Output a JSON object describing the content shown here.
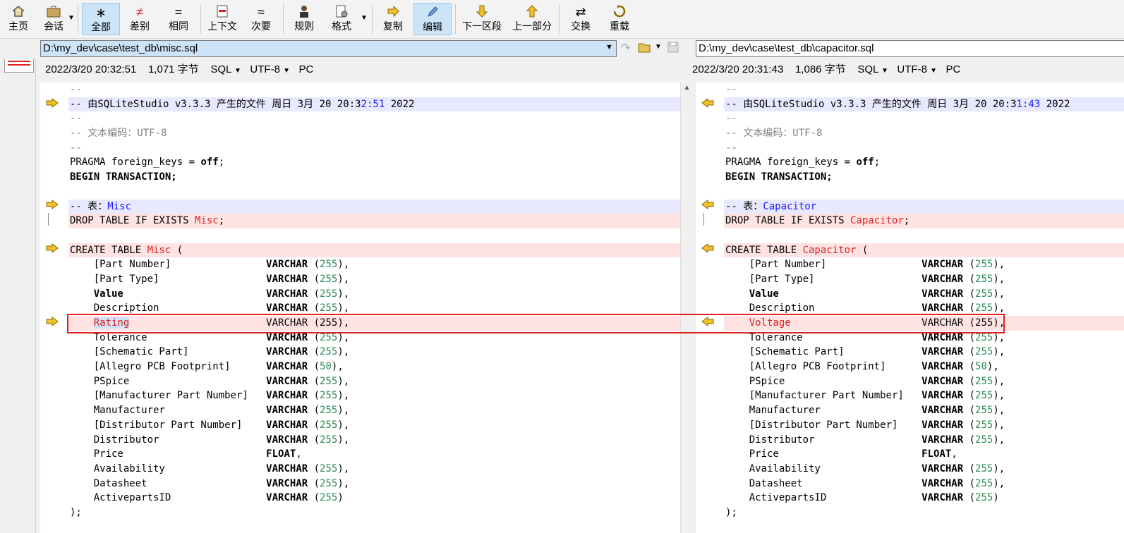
{
  "toolbar": {
    "home": "主页",
    "session": "会话",
    "all": "全部",
    "diffs": "差别",
    "same": "相同",
    "context": "上下文",
    "minor": "次要",
    "rules": "规则",
    "format": "格式",
    "copy": "复制",
    "edit": "编辑",
    "next_section": "下一区段",
    "prev_part": "上一部分",
    "swap": "交换",
    "reload": "重载"
  },
  "left": {
    "path": "D:\\my_dev\\case\\test_db\\misc.sql",
    "date": "2022/3/20 20:32:51",
    "size": "1,071 字节",
    "format": "SQL",
    "encoding": "UTF-8",
    "lineend": "PC",
    "header_time_a": "-- 由SQLiteStudio v3.3.3 产生的文件 周日 3月 20 20:3",
    "header_time_b": "2:51",
    "header_time_c": " 2022",
    "table_name": "Misc",
    "changed_col": "Rating"
  },
  "right": {
    "path": "D:\\my_dev\\case\\test_db\\capacitor.sql",
    "date": "2022/3/20 20:31:43",
    "size": "1,086 字节",
    "format": "SQL",
    "encoding": "UTF-8",
    "lineend": "PC",
    "header_time_a": "-- 由SQLiteStudio v3.3.3 产生的文件 周日 3月 20 20:3",
    "header_time_b": "1:43",
    "header_time_c": " 2022",
    "table_name": "Capacitor",
    "changed_col": "Voltage"
  },
  "code": {
    "c_dash": "--",
    "c_enc": "-- 文本编码：UTF-8",
    "pragma_a": "PRAGMA foreign_keys = ",
    "pragma_b": "off",
    "pragma_c": ";",
    "begin": "BEGIN TRANSACTION;",
    "table_comment": "-- 表：",
    "drop_a": "DROP TABLE IF EXISTS ",
    "drop_c": ";",
    "create_a": "CREATE TABLE ",
    "create_c": " (",
    "close": ");",
    "columns": [
      {
        "name": "[Part Number]",
        "type": "VARCHAR",
        "arg": "255",
        "end": "),"
      },
      {
        "name": "[Part Type]",
        "type": "VARCHAR",
        "arg": "255",
        "end": "),"
      },
      {
        "name": "Value",
        "type": "VARCHAR",
        "arg": "255",
        "end": "),"
      },
      {
        "name": "Description",
        "type": "VARCHAR",
        "arg": "255",
        "end": "),"
      },
      {
        "name": "Tolerance",
        "type": "VARCHAR",
        "arg": "255",
        "end": "),"
      },
      {
        "name": "[Schematic Part]",
        "type": "VARCHAR",
        "arg": "255",
        "end": "),"
      },
      {
        "name": "[Allegro PCB Footprint]",
        "type": "VARCHAR",
        "arg": "50",
        "end": "),"
      },
      {
        "name": "PSpice",
        "type": "VARCHAR",
        "arg": "255",
        "end": "),"
      },
      {
        "name": "[Manufacturer Part Number]",
        "type": "VARCHAR",
        "arg": "255",
        "end": "),"
      },
      {
        "name": "Manufacturer",
        "type": "VARCHAR",
        "arg": "255",
        "end": "),"
      },
      {
        "name": "[Distributor Part Number]",
        "type": "VARCHAR",
        "arg": "255",
        "end": "),"
      },
      {
        "name": "Distributor",
        "type": "VARCHAR",
        "arg": "255",
        "end": "),"
      },
      {
        "name": "Price",
        "type": "FLOAT",
        "arg": "",
        "end": ","
      },
      {
        "name": "Availability",
        "type": "VARCHAR",
        "arg": "255",
        "end": "),"
      },
      {
        "name": "Datasheet",
        "type": "VARCHAR",
        "arg": "255",
        "end": "),"
      },
      {
        "name": "ActivepartsID",
        "type": "VARCHAR",
        "arg": "255",
        "end": ")"
      }
    ],
    "changed_type": "VARCHAR (255),"
  },
  "colors": {
    "diff_bg": "#ffe3e3",
    "mod_bg": "#e8e8ff",
    "accent_red": "#e02020",
    "accent_blue": "#1a1aff"
  }
}
